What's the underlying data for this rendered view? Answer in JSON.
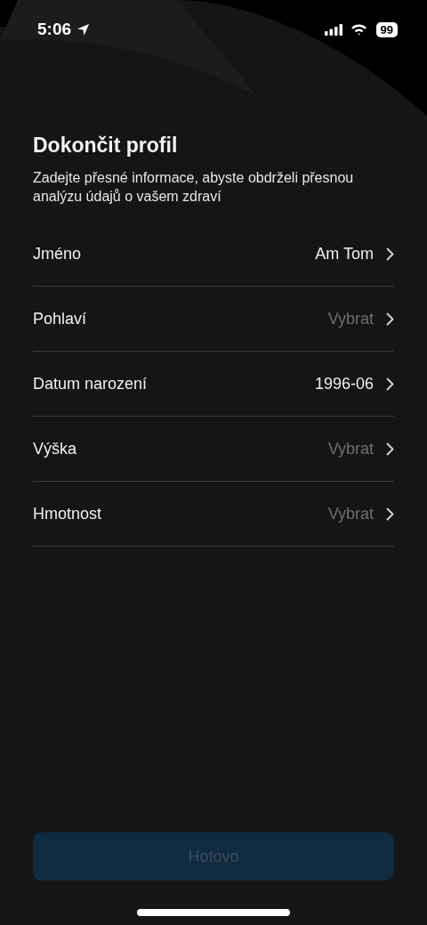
{
  "status_bar": {
    "time": "5:06",
    "battery": "99"
  },
  "title": "Dokončit profil",
  "subtitle": "Zadejte přesné informace, abyste obdrželi přesnou analýzu údajů o vašem zdraví",
  "fields": [
    {
      "label": "Jméno",
      "value": "Am Tom"
    },
    {
      "label": "Pohlaví",
      "placeholder": "Vybrat"
    },
    {
      "label": "Datum narození",
      "value": "1996-06"
    },
    {
      "label": "Výška",
      "placeholder": "Vybrat"
    },
    {
      "label": "Hmotnost",
      "placeholder": "Vybrat"
    }
  ],
  "done_button": {
    "label": "Hotovo",
    "disabled": true
  }
}
